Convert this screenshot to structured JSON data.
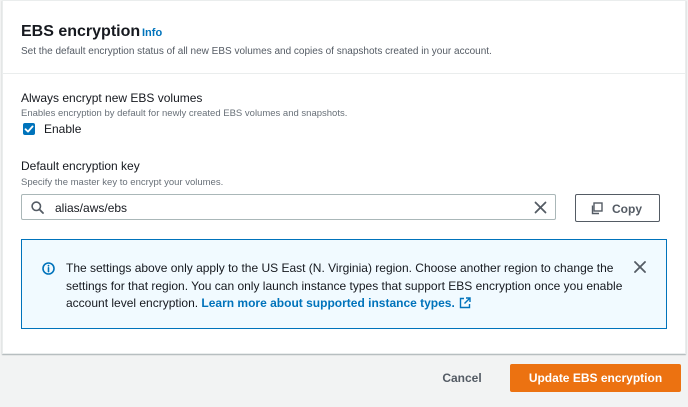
{
  "panel": {
    "title": "EBS encryption",
    "info_label": "Info",
    "description": "Set the default encryption status of all new EBS volumes and copies of snapshots created in your account."
  },
  "always_encrypt": {
    "label": "Always encrypt new EBS volumes",
    "description": "Enables encryption by default for newly created EBS volumes and snapshots.",
    "checkbox_label": "Enable",
    "checked": true
  },
  "default_key": {
    "label": "Default encryption key",
    "description": "Specify the master key to encrypt your volumes.",
    "value": "alias/aws/ebs",
    "copy_label": "Copy"
  },
  "alert": {
    "text": "The settings above only apply to the US East (N. Virginia) region. Choose another region to change the settings for that region. You can only launch instance types that support EBS encryption once you enable account level encryption. ",
    "link_text": "Learn more about supported instance types."
  },
  "footer": {
    "cancel_label": "Cancel",
    "submit_label": "Update EBS encryption"
  },
  "colors": {
    "accent": "#0073bb",
    "primary_button": "#ec7211",
    "alert_bg": "#f1faff"
  }
}
